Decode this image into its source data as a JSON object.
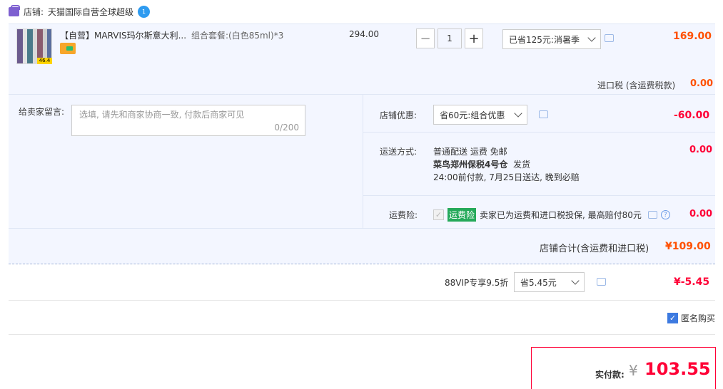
{
  "shop": {
    "label": "店铺:",
    "name": "天猫国际自营全球超级",
    "badge": "1"
  },
  "item": {
    "title": "【自营】MARVIS玛尔斯意大利...",
    "sku": "组合套餐:(白色85ml)*3",
    "thumb_tag": "46.4",
    "unit_price": "294.00",
    "qty_minus": "−",
    "quantity": "1",
    "qty_plus": "+",
    "discount_select": "已省125元:消暑季",
    "subtotal": "169.00"
  },
  "import_tax": {
    "label": "进口税 (含运费税款)",
    "value": "0.00"
  },
  "message": {
    "label": "给卖家留言:",
    "placeholder": "选填, 请先和商家协商一致, 付款后商家可见",
    "count": "0/200"
  },
  "shop_discount": {
    "label": "店铺优惠:",
    "select": "省60元:组合优惠",
    "value": "-60.00"
  },
  "shipping": {
    "label": "运送方式:",
    "line1": "普通配送 运费 免邮",
    "line2_bold": "菜鸟郑州保税4号仓",
    "line2_rest": "发货",
    "line3": "24:00前付款, 7月25日送达, 晚到必赔",
    "value": "0.00"
  },
  "insurance": {
    "label": "运费险:",
    "tag": "运费险",
    "desc": "卖家已为运费和进口税投保, 最高赔付80元",
    "help": "?",
    "value": "0.00"
  },
  "shop_total": {
    "label": "店铺合计(含运费和进口税)",
    "value": "¥109.00"
  },
  "vip": {
    "label": "88VIP专享9.5折",
    "select": "省5.45元",
    "value": "¥-5.45"
  },
  "anonymous": {
    "label": "匿名购买",
    "checked": true
  },
  "payment": {
    "label": "实付款:",
    "currency": "¥",
    "amount": "103.55"
  },
  "colors": {
    "accent_red": "#ff0036",
    "accent_orange": "#ff5000",
    "row_bg": "#f3f6ff",
    "insurance_green": "#25a95a",
    "checkbox_blue": "#3d7ae0"
  },
  "icons": [
    "shop-icon",
    "chat-icon",
    "chevron-down-icon",
    "help-icon",
    "check-icon",
    "card-icon"
  ]
}
